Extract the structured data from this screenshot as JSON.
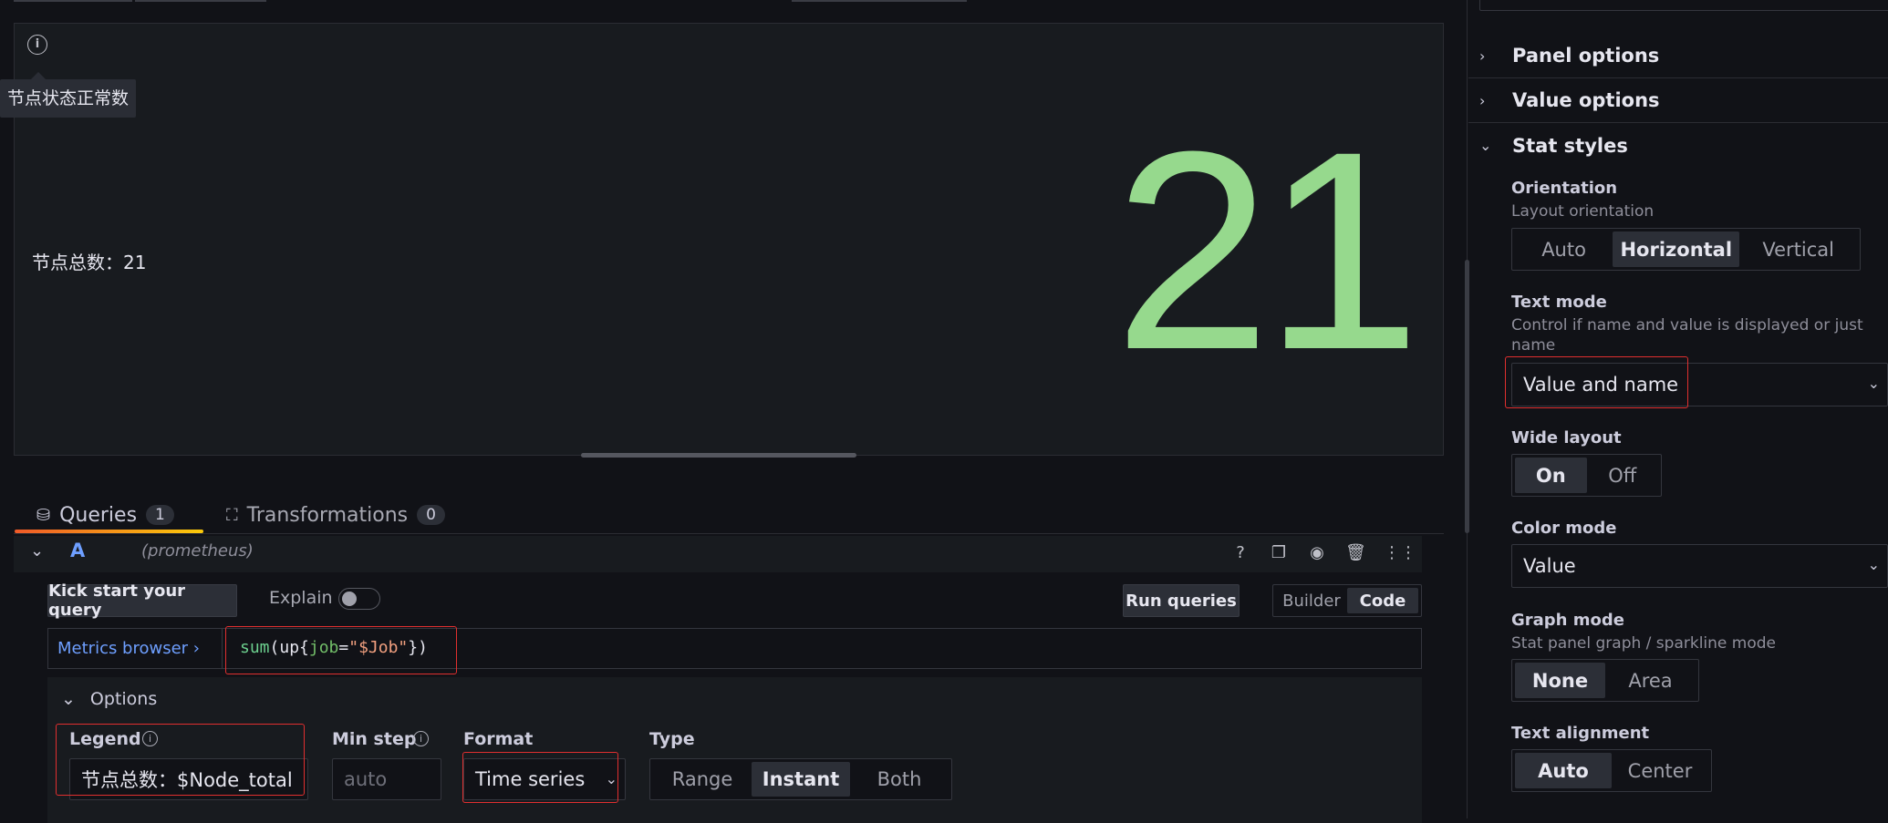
{
  "panel": {
    "tooltip": "节点状态正常数",
    "stat_name": "节点总数：21",
    "stat_value": "21"
  },
  "tabs": [
    {
      "label": "Queries",
      "count": "1"
    },
    {
      "label": "Transformations",
      "count": "0"
    }
  ],
  "query": {
    "ref": "A",
    "datasource": "(prometheus)",
    "kick_start": "Kick start your query",
    "explain": "Explain",
    "run": "Run queries",
    "modes": [
      "Builder",
      "Code"
    ],
    "metrics_browser": "Metrics browser ›",
    "expr": {
      "fn": "sum",
      "open": "(up{",
      "label": "job",
      "eq": "=",
      "value": "\"$Job\"",
      "close": "})"
    },
    "options_title": "Options",
    "legend_label": "Legend",
    "legend_value": "节点总数：$Node_total",
    "minstep_label": "Min step",
    "minstep_placeholder": "auto",
    "format_label": "Format",
    "format_value": "Time series",
    "type_label": "Type",
    "type_options": [
      "Range",
      "Instant",
      "Both"
    ]
  },
  "right_pane": {
    "sections": [
      "Panel options",
      "Value options",
      "Stat styles"
    ],
    "orientation": {
      "label": "Orientation",
      "desc": "Layout orientation",
      "options": [
        "Auto",
        "Horizontal",
        "Vertical"
      ]
    },
    "text_mode": {
      "label": "Text mode",
      "desc": "Control if name and value is displayed or just name",
      "value": "Value and name"
    },
    "wide_layout": {
      "label": "Wide layout",
      "options": [
        "On",
        "Off"
      ]
    },
    "color_mode": {
      "label": "Color mode",
      "value": "Value"
    },
    "graph_mode": {
      "label": "Graph mode",
      "desc": "Stat panel graph / sparkline mode",
      "options": [
        "None",
        "Area"
      ]
    },
    "text_alignment": {
      "label": "Text alignment",
      "options": [
        "Auto",
        "Center"
      ]
    }
  },
  "colors": {
    "stat": "#96d98d",
    "accent": "#6e9fff",
    "highlight": "#e02f2f"
  }
}
